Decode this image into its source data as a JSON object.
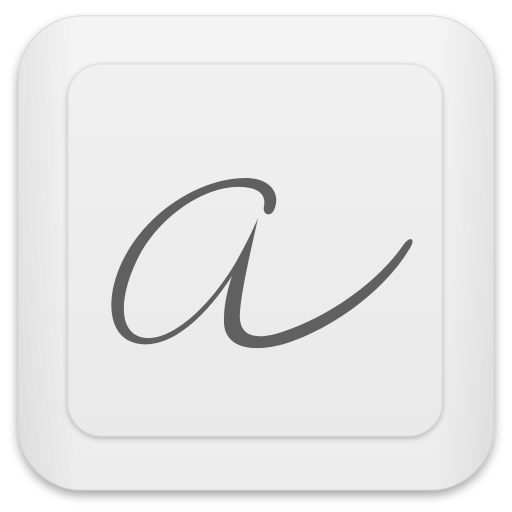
{
  "icon": {
    "name": "keycap-script-a-icon",
    "glyph": "a",
    "colors": {
      "key_outer": "#f2f2f2",
      "key_face": "#ececec",
      "glyph": "#606060",
      "background": "#ffffff"
    }
  }
}
